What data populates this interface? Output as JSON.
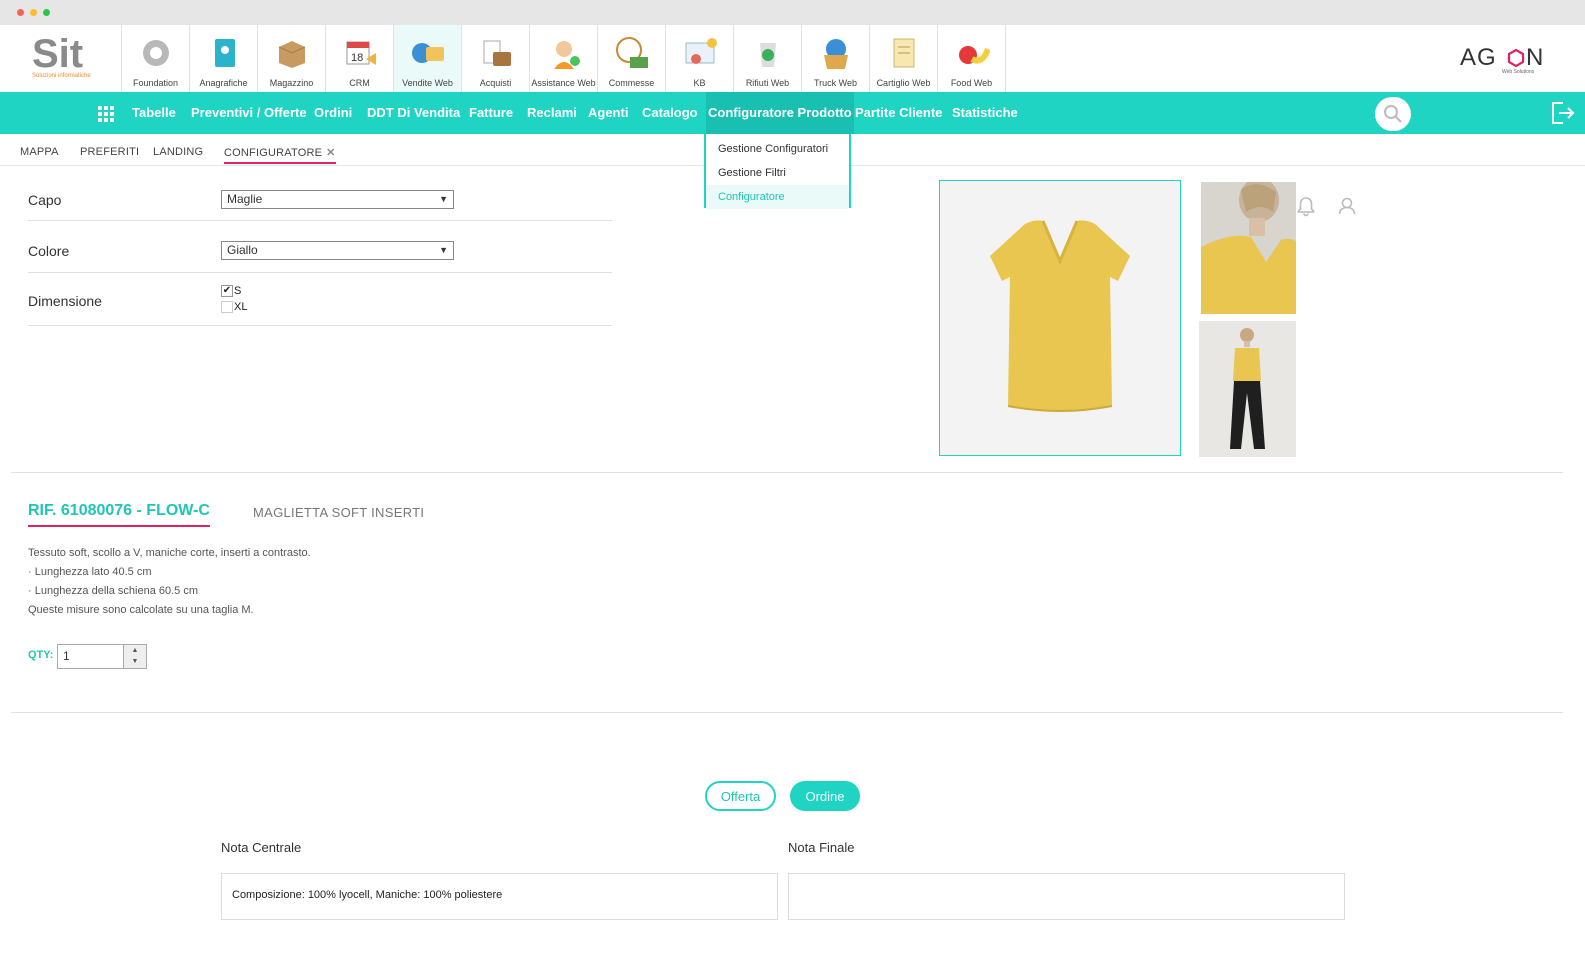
{
  "brand": {
    "logo_text": "Sit",
    "logo_tagline": "Soluzioni informatiche",
    "partner_logo": "AGON",
    "partner_tagline": "Web Solutions"
  },
  "apps": [
    {
      "label": "Foundation",
      "icon": "gear-icon"
    },
    {
      "label": "Anagrafiche",
      "icon": "address-book-icon"
    },
    {
      "label": "Magazzino",
      "icon": "box-icon"
    },
    {
      "label": "CRM",
      "icon": "calendar-icon"
    },
    {
      "label": "Vendite Web",
      "icon": "globe-handshake-icon"
    },
    {
      "label": "Acquisti",
      "icon": "briefcase-icon"
    },
    {
      "label": "Assistance Web",
      "icon": "support-agent-icon"
    },
    {
      "label": "Commesse",
      "icon": "clock-money-icon"
    },
    {
      "label": "KB",
      "icon": "knowledge-icon"
    },
    {
      "label": "Rifiuti Web",
      "icon": "recycle-icon"
    },
    {
      "label": "Truck Web",
      "icon": "globe-box-icon"
    },
    {
      "label": "Cartiglio Web",
      "icon": "document-icon"
    },
    {
      "label": "Food Web",
      "icon": "fruit-icon"
    }
  ],
  "nav": {
    "items": [
      "Tabelle",
      "Preventivi / Offerte",
      "Ordini",
      "DDT Di Vendita",
      "Fatture",
      "Reclami",
      "Agenti",
      "Catalogo",
      "Configuratore Prodotto",
      "Partite Cliente",
      "Statistiche"
    ],
    "active": "Configuratore Prodotto",
    "dropdown": [
      "Gestione Configuratori",
      "Gestione Filtri",
      "Configuratore"
    ],
    "dropdown_selected": "Configuratore"
  },
  "subtabs": [
    "MAPPA",
    "PREFERITI",
    "LANDING",
    "CONFIGURATORE"
  ],
  "subtab_close": "✕",
  "form": {
    "capo": {
      "label": "Capo",
      "value": "Maglie"
    },
    "colore": {
      "label": "Colore",
      "value": "Giallo"
    },
    "dimensione": {
      "label": "Dimensione",
      "options": [
        {
          "label": "S",
          "checked": true
        },
        {
          "label": "XL",
          "checked": false
        }
      ]
    }
  },
  "product": {
    "ref": "RIF. 61080076 - FLOW-C",
    "name": "MAGLIETTA SOFT INSERTI",
    "description": [
      "Tessuto soft, scollo a V, maniche corte, inserti a contrasto.",
      "· Lunghezza lato 40.5 cm",
      "· Lunghezza della schiena 60.5 cm",
      "Queste misure sono calcolate su una taglia M."
    ],
    "qty_label": "QTY:",
    "qty": "1"
  },
  "actions": {
    "offerta": "Offerta",
    "ordine": "Ordine"
  },
  "notes": {
    "centrale_label": "Nota Centrale",
    "centrale_value": "Composizione: 100% lyocell, Maniche: 100% poliestere",
    "finale_label": "Nota Finale",
    "finale_value": ""
  },
  "colors": {
    "accent": "#20d4c4",
    "highlight": "#e0245e",
    "shirt": "#e8c650"
  }
}
